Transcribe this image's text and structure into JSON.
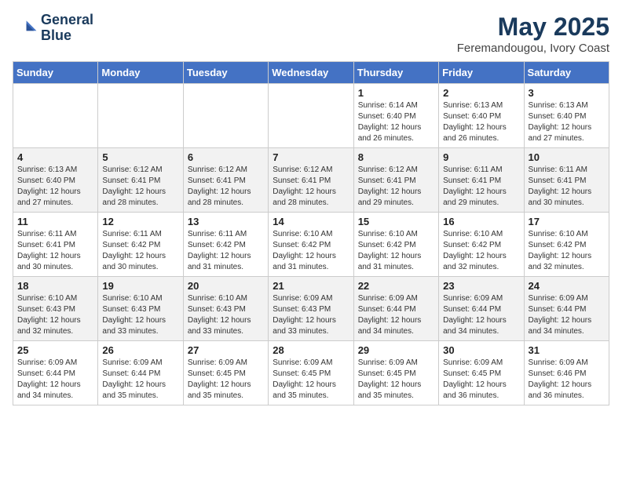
{
  "header": {
    "logo_line1": "General",
    "logo_line2": "Blue",
    "month_title": "May 2025",
    "location": "Feremandougou, Ivory Coast"
  },
  "days_of_week": [
    "Sunday",
    "Monday",
    "Tuesday",
    "Wednesday",
    "Thursday",
    "Friday",
    "Saturday"
  ],
  "weeks": [
    [
      {
        "day": "",
        "info": ""
      },
      {
        "day": "",
        "info": ""
      },
      {
        "day": "",
        "info": ""
      },
      {
        "day": "",
        "info": ""
      },
      {
        "day": "1",
        "info": "Sunrise: 6:14 AM\nSunset: 6:40 PM\nDaylight: 12 hours\nand 26 minutes."
      },
      {
        "day": "2",
        "info": "Sunrise: 6:13 AM\nSunset: 6:40 PM\nDaylight: 12 hours\nand 26 minutes."
      },
      {
        "day": "3",
        "info": "Sunrise: 6:13 AM\nSunset: 6:40 PM\nDaylight: 12 hours\nand 27 minutes."
      }
    ],
    [
      {
        "day": "4",
        "info": "Sunrise: 6:13 AM\nSunset: 6:40 PM\nDaylight: 12 hours\nand 27 minutes."
      },
      {
        "day": "5",
        "info": "Sunrise: 6:12 AM\nSunset: 6:41 PM\nDaylight: 12 hours\nand 28 minutes."
      },
      {
        "day": "6",
        "info": "Sunrise: 6:12 AM\nSunset: 6:41 PM\nDaylight: 12 hours\nand 28 minutes."
      },
      {
        "day": "7",
        "info": "Sunrise: 6:12 AM\nSunset: 6:41 PM\nDaylight: 12 hours\nand 28 minutes."
      },
      {
        "day": "8",
        "info": "Sunrise: 6:12 AM\nSunset: 6:41 PM\nDaylight: 12 hours\nand 29 minutes."
      },
      {
        "day": "9",
        "info": "Sunrise: 6:11 AM\nSunset: 6:41 PM\nDaylight: 12 hours\nand 29 minutes."
      },
      {
        "day": "10",
        "info": "Sunrise: 6:11 AM\nSunset: 6:41 PM\nDaylight: 12 hours\nand 30 minutes."
      }
    ],
    [
      {
        "day": "11",
        "info": "Sunrise: 6:11 AM\nSunset: 6:41 PM\nDaylight: 12 hours\nand 30 minutes."
      },
      {
        "day": "12",
        "info": "Sunrise: 6:11 AM\nSunset: 6:42 PM\nDaylight: 12 hours\nand 30 minutes."
      },
      {
        "day": "13",
        "info": "Sunrise: 6:11 AM\nSunset: 6:42 PM\nDaylight: 12 hours\nand 31 minutes."
      },
      {
        "day": "14",
        "info": "Sunrise: 6:10 AM\nSunset: 6:42 PM\nDaylight: 12 hours\nand 31 minutes."
      },
      {
        "day": "15",
        "info": "Sunrise: 6:10 AM\nSunset: 6:42 PM\nDaylight: 12 hours\nand 31 minutes."
      },
      {
        "day": "16",
        "info": "Sunrise: 6:10 AM\nSunset: 6:42 PM\nDaylight: 12 hours\nand 32 minutes."
      },
      {
        "day": "17",
        "info": "Sunrise: 6:10 AM\nSunset: 6:42 PM\nDaylight: 12 hours\nand 32 minutes."
      }
    ],
    [
      {
        "day": "18",
        "info": "Sunrise: 6:10 AM\nSunset: 6:43 PM\nDaylight: 12 hours\nand 32 minutes."
      },
      {
        "day": "19",
        "info": "Sunrise: 6:10 AM\nSunset: 6:43 PM\nDaylight: 12 hours\nand 33 minutes."
      },
      {
        "day": "20",
        "info": "Sunrise: 6:10 AM\nSunset: 6:43 PM\nDaylight: 12 hours\nand 33 minutes."
      },
      {
        "day": "21",
        "info": "Sunrise: 6:09 AM\nSunset: 6:43 PM\nDaylight: 12 hours\nand 33 minutes."
      },
      {
        "day": "22",
        "info": "Sunrise: 6:09 AM\nSunset: 6:44 PM\nDaylight: 12 hours\nand 34 minutes."
      },
      {
        "day": "23",
        "info": "Sunrise: 6:09 AM\nSunset: 6:44 PM\nDaylight: 12 hours\nand 34 minutes."
      },
      {
        "day": "24",
        "info": "Sunrise: 6:09 AM\nSunset: 6:44 PM\nDaylight: 12 hours\nand 34 minutes."
      }
    ],
    [
      {
        "day": "25",
        "info": "Sunrise: 6:09 AM\nSunset: 6:44 PM\nDaylight: 12 hours\nand 34 minutes."
      },
      {
        "day": "26",
        "info": "Sunrise: 6:09 AM\nSunset: 6:44 PM\nDaylight: 12 hours\nand 35 minutes."
      },
      {
        "day": "27",
        "info": "Sunrise: 6:09 AM\nSunset: 6:45 PM\nDaylight: 12 hours\nand 35 minutes."
      },
      {
        "day": "28",
        "info": "Sunrise: 6:09 AM\nSunset: 6:45 PM\nDaylight: 12 hours\nand 35 minutes."
      },
      {
        "day": "29",
        "info": "Sunrise: 6:09 AM\nSunset: 6:45 PM\nDaylight: 12 hours\nand 35 minutes."
      },
      {
        "day": "30",
        "info": "Sunrise: 6:09 AM\nSunset: 6:45 PM\nDaylight: 12 hours\nand 36 minutes."
      },
      {
        "day": "31",
        "info": "Sunrise: 6:09 AM\nSunset: 6:46 PM\nDaylight: 12 hours\nand 36 minutes."
      }
    ]
  ]
}
